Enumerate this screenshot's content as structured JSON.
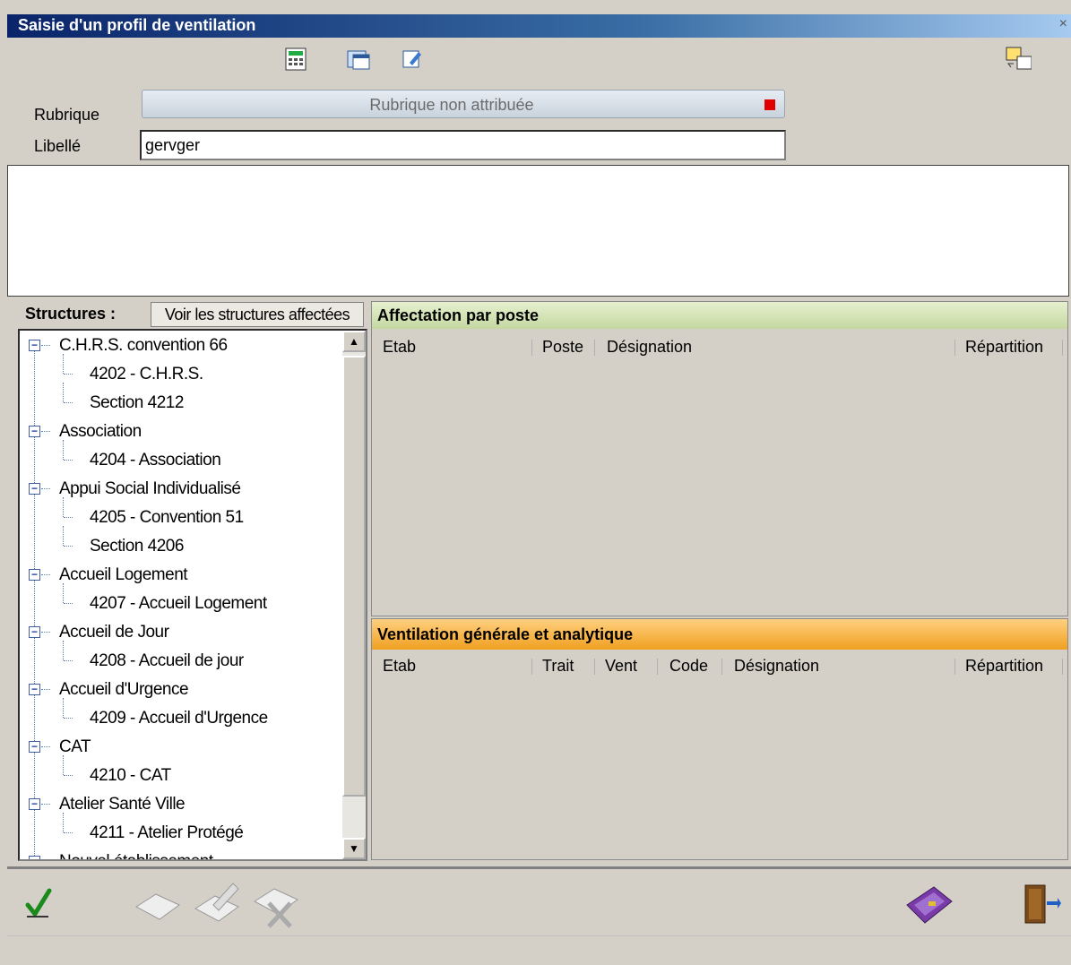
{
  "window": {
    "title": "Saisie d'un profil de ventilation",
    "close": "×"
  },
  "toolbar": {
    "icons": [
      "calculator-icon",
      "window-icon",
      "edit-icon",
      "swap-icon"
    ]
  },
  "form": {
    "rubrique_label": "Rubrique",
    "rubrique_value": "Rubrique non attribuée",
    "libelle_label": "Libellé",
    "libelle_value": "gervger"
  },
  "structures": {
    "title": "Structures :",
    "button": "Voir les structures affectées",
    "tree": [
      {
        "label": "C.H.R.S. convention 66",
        "level": 0
      },
      {
        "label": "4202 - C.H.R.S.",
        "level": 1
      },
      {
        "label": "Section 4212",
        "level": 1
      },
      {
        "label": "Association",
        "level": 0
      },
      {
        "label": "4204 - Association",
        "level": 1
      },
      {
        "label": "Appui Social Individualisé",
        "level": 0
      },
      {
        "label": "4205 - Convention 51",
        "level": 1
      },
      {
        "label": "Section 4206",
        "level": 1
      },
      {
        "label": "Accueil Logement",
        "level": 0
      },
      {
        "label": "4207 - Accueil Logement",
        "level": 1
      },
      {
        "label": "Accueil de Jour",
        "level": 0
      },
      {
        "label": "4208 - Accueil de jour",
        "level": 1
      },
      {
        "label": "Accueil d'Urgence",
        "level": 0
      },
      {
        "label": "4209 - Accueil d'Urgence",
        "level": 1
      },
      {
        "label": "CAT",
        "level": 0
      },
      {
        "label": "4210 - CAT",
        "level": 1
      },
      {
        "label": "Atelier Santé Ville",
        "level": 0
      },
      {
        "label": "4211 - Atelier Protégé",
        "level": 1
      },
      {
        "label": "Nouvel établissement",
        "level": 0
      }
    ]
  },
  "affectation": {
    "title": "Affectation par poste",
    "columns": [
      "Etab",
      "Poste",
      "Désignation",
      "Répartition"
    ]
  },
  "ventilation": {
    "title": "Ventilation générale et analytique",
    "columns": [
      "Etab",
      "Trait",
      "Vent",
      "Code",
      "Désignation",
      "Répartition"
    ]
  },
  "bottom": {
    "icons": [
      "validate-check-icon",
      "new-icon",
      "edit-pen-icon",
      "delete-icon",
      "wallet-icon",
      "exit-door-icon"
    ]
  }
}
